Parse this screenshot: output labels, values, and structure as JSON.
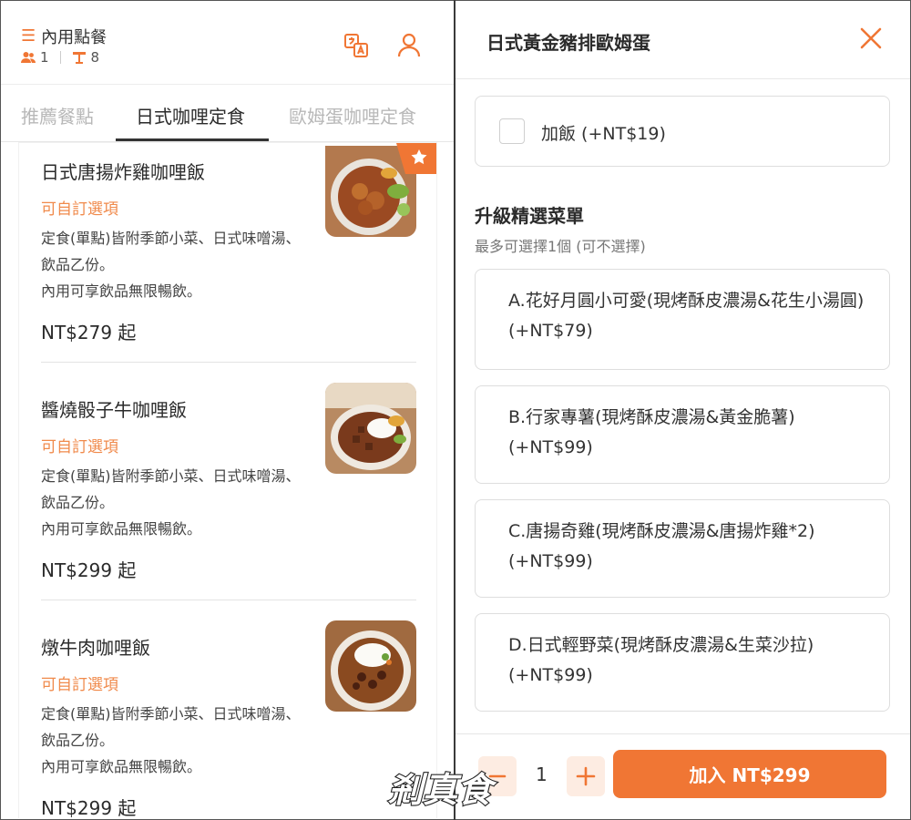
{
  "colors": {
    "accent": "#f07634",
    "accent_light": "#fdece2",
    "text": "#2b2b2b",
    "muted": "#b8b8b8"
  },
  "left": {
    "header": {
      "mode_label": "內用點餐",
      "guests": "1",
      "table": "8",
      "icons": [
        "menu-icon",
        "people-icon",
        "table-icon",
        "translate-icon",
        "user-icon"
      ]
    },
    "tabs": [
      {
        "label": "推薦餐點",
        "active": false
      },
      {
        "label": "日式咖哩定食",
        "active": true
      },
      {
        "label": "歐姆蛋咖哩定食",
        "active": false
      }
    ],
    "items": [
      {
        "name": "日式唐揚炸雞咖哩飯",
        "custom": "可自訂選項",
        "desc": "定食(單點)皆附季節小菜、日式味噌湯、飲品乙份。",
        "desc2": "內用可享飲品無限暢飲。",
        "price": "NT$279 起",
        "featured": true
      },
      {
        "name": "醬燒骰子牛咖哩飯",
        "custom": "可自訂選項",
        "desc": "定食(單點)皆附季節小菜、日式味噌湯、飲品乙份。",
        "desc2": "內用可享飲品無限暢飲。",
        "price": "NT$299 起",
        "featured": false
      },
      {
        "name": "燉牛肉咖哩飯",
        "custom": "可自訂選項",
        "desc": "定食(單點)皆附季節小菜、日式味噌湯、飲品乙份。",
        "desc2": "內用可享飲品無限暢飲。",
        "price": "NT$299 起",
        "featured": false
      }
    ]
  },
  "right": {
    "title": "日式黃金豬排歐姆蛋",
    "addon": {
      "label": "加飯 (+NT$19)",
      "checked": false
    },
    "upgrade": {
      "title": "升級精選菜單",
      "subtitle": "最多可選擇1個 (可不選擇)",
      "options": [
        "A.花好月圓小可愛(現烤酥皮濃湯&花生小湯圓) (+NT$79)",
        "B.行家專薯(現烤酥皮濃湯&黃金脆薯)(+NT$99)",
        "C.唐揚奇雞(現烤酥皮濃湯&唐揚炸雞*2)(+NT$99)",
        "D.日式輕野菜(現烤酥皮濃湯&生菜沙拉)(+NT$99)"
      ]
    },
    "quantity": "1",
    "add_button": "加入 NT$299"
  },
  "watermark": {
    "text": "剎真食"
  }
}
